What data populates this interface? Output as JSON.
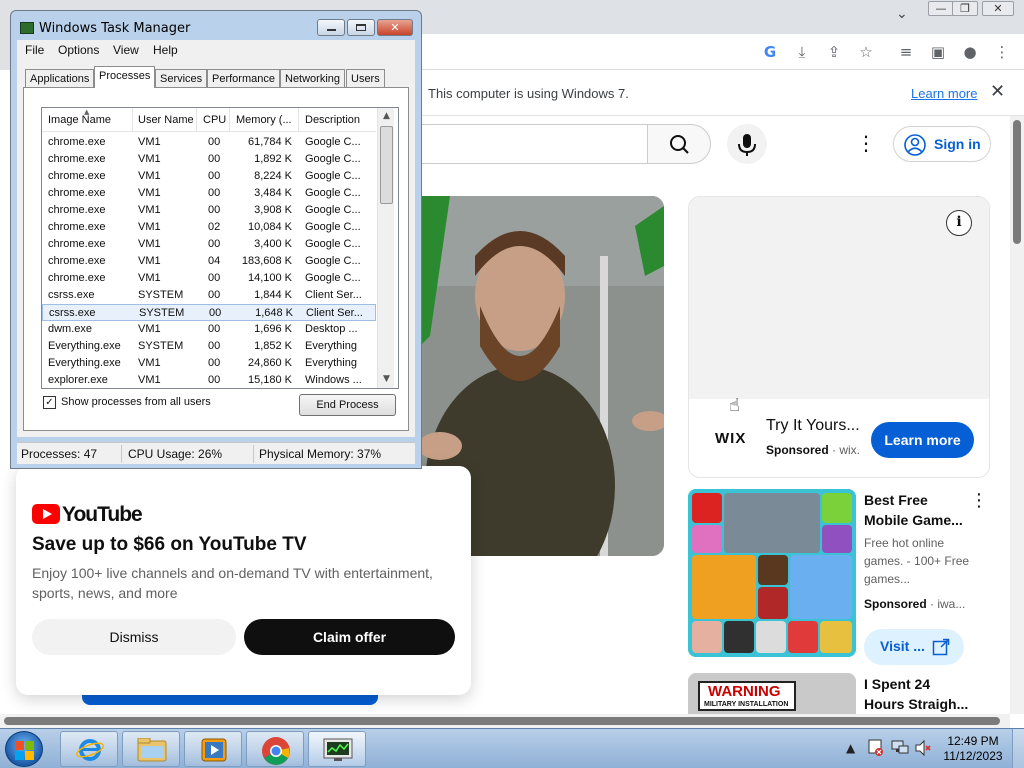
{
  "chrome": {
    "window_controls": {
      "minimize": "—",
      "maximize": "❐",
      "close": "✕"
    },
    "tab_list_icon": "chevron-down-icon",
    "toolbar_icons": [
      "google-lens-icon",
      "install-app-icon",
      "share-icon",
      "bookmark-star-icon",
      "reading-list-icon",
      "side-panel-icon",
      "profile-icon",
      "kebab-menu-icon"
    ],
    "infobar": {
      "message": "This computer is using Windows 7.",
      "link": "Learn more",
      "close": "✕"
    }
  },
  "youtube": {
    "header": {
      "search_icon": "search-icon",
      "mic_icon": "mic-icon",
      "more": "⋮",
      "sign_in": "Sign in"
    },
    "ad_card": {
      "brand": "WIX",
      "title": "Try It Yours...",
      "sponsored": "Sponsored",
      "domain": "· wix.",
      "cta": "Learn more"
    },
    "game_ad": {
      "title": "Best Free Mobile Game...",
      "desc": "Free hot online games. - 100+ Free games...",
      "sponsored": "Sponsored",
      "domain": "· iwa...",
      "cta": "Visit ...",
      "more": "⋮"
    },
    "video_3": {
      "thumb_warning": "WARNING",
      "thumb_sub": "MILITARY INSTALLATION",
      "title": "I Spent 24 Hours Straigh..."
    },
    "promo": {
      "logo": "YouTube",
      "title": "Save up to $66 on YouTube TV",
      "body": "Enjoy 100+ live channels and on-demand TV with entertainment, sports, news, and more",
      "dismiss": "Dismiss",
      "claim": "Claim offer"
    }
  },
  "task_manager": {
    "title": "Windows Task Manager",
    "controls": {
      "close": "✕"
    },
    "menu": [
      "File",
      "Options",
      "View",
      "Help"
    ],
    "tabs": [
      "Applications",
      "Processes",
      "Services",
      "Performance",
      "Networking",
      "Users"
    ],
    "active_tab": "Processes",
    "columns": [
      "Image Name",
      "User Name",
      "CPU",
      "Memory (...",
      "Description"
    ],
    "rows": [
      [
        "chrome.exe",
        "VM1",
        "00",
        "61,784 K",
        "Google C..."
      ],
      [
        "chrome.exe",
        "VM1",
        "00",
        "1,892 K",
        "Google C..."
      ],
      [
        "chrome.exe",
        "VM1",
        "00",
        "8,224 K",
        "Google C..."
      ],
      [
        "chrome.exe",
        "VM1",
        "00",
        "3,484 K",
        "Google C..."
      ],
      [
        "chrome.exe",
        "VM1",
        "00",
        "3,908 K",
        "Google C..."
      ],
      [
        "chrome.exe",
        "VM1",
        "02",
        "10,084 K",
        "Google C..."
      ],
      [
        "chrome.exe",
        "VM1",
        "00",
        "3,400 K",
        "Google C..."
      ],
      [
        "chrome.exe",
        "VM1",
        "04",
        "183,608 K",
        "Google C..."
      ],
      [
        "chrome.exe",
        "VM1",
        "00",
        "14,100 K",
        "Google C..."
      ],
      [
        "csrss.exe",
        "SYSTEM",
        "00",
        "1,844 K",
        "Client Ser..."
      ],
      [
        "csrss.exe",
        "SYSTEM",
        "00",
        "1,648 K",
        "Client Ser..."
      ],
      [
        "dwm.exe",
        "VM1",
        "00",
        "1,696 K",
        "Desktop ..."
      ],
      [
        "Everything.exe",
        "SYSTEM",
        "00",
        "1,852 K",
        "Everything"
      ],
      [
        "Everything.exe",
        "VM1",
        "00",
        "24,860 K",
        "Everything"
      ],
      [
        "explorer.exe",
        "VM1",
        "00",
        "15,180 K",
        "Windows ..."
      ]
    ],
    "selected_row": 10,
    "show_all_users": "Show processes from all users",
    "show_all_checked": "✓",
    "end_process": "End Process",
    "status": {
      "processes": "Processes: 47",
      "cpu": "CPU Usage: 26%",
      "memory": "Physical Memory: 37%"
    }
  },
  "taskbar": {
    "apps": [
      "internet-explorer-icon",
      "file-explorer-icon",
      "media-player-icon",
      "chrome-icon",
      "task-manager-icon"
    ],
    "active_app": "task-manager-icon",
    "tray": {
      "show_hidden": "▲"
    },
    "clock": {
      "time": "12:49 PM",
      "date": "11/12/2023"
    }
  }
}
